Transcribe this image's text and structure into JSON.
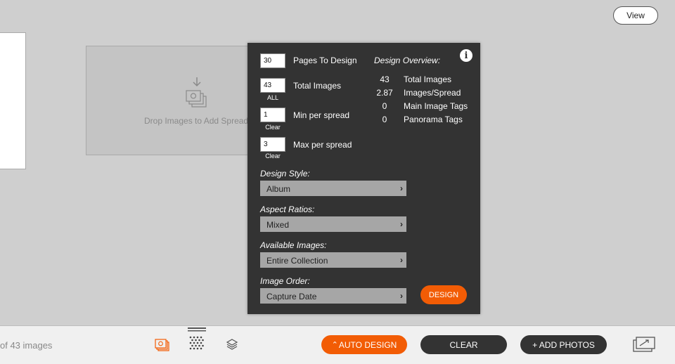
{
  "header": {
    "view_label": "View"
  },
  "canvas": {
    "drop_text": "Drop Images to Add Spread"
  },
  "panel": {
    "pages_to_design": {
      "value": "30",
      "label": "Pages To Design"
    },
    "total_images": {
      "value": "43",
      "label": "Total Images",
      "sub": "ALL"
    },
    "min_per_spread": {
      "value": "1",
      "label": "Min per spread",
      "sub": "Clear"
    },
    "max_per_spread": {
      "value": "3",
      "label": "Max per spread",
      "sub": "Clear"
    },
    "design_style": {
      "label": "Design Style:",
      "value": "Album"
    },
    "aspect_ratios": {
      "label": "Aspect Ratios:",
      "value": "Mixed"
    },
    "available_images": {
      "label": "Available Images:",
      "value": "Entire Collection"
    },
    "image_order": {
      "label": "Image Order:",
      "value": "Capture Date"
    },
    "design_button": "DESIGN",
    "overview": {
      "title": "Design Overview:",
      "rows": [
        {
          "value": "43",
          "label": "Total Images"
        },
        {
          "value": "2.87",
          "label": "Images/Spread"
        },
        {
          "value": "0",
          "label": "Main Image Tags"
        },
        {
          "value": "0",
          "label": "Panorama Tags"
        }
      ]
    },
    "info_icon": "info-icon"
  },
  "bottom_bar": {
    "count_text": "of 43 images",
    "auto_design": "AUTO DESIGN",
    "clear": "CLEAR",
    "add_photos": "+ ADD PHOTOS"
  },
  "colors": {
    "accent": "#f25c05",
    "panel_bg": "#333333",
    "canvas_bg": "#cfcfcf"
  }
}
